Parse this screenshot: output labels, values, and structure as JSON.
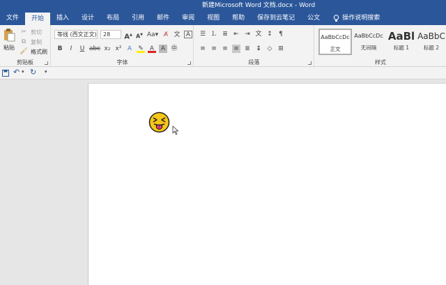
{
  "window": {
    "title": "新建Microsoft Word 文档.docx  -  Word"
  },
  "tabs": [
    "文件",
    "开始",
    "插入",
    "设计",
    "布局",
    "引用",
    "邮件",
    "审阅",
    "视图",
    "帮助",
    "保存到云笔记",
    "公文"
  ],
  "tell_me": {
    "label": "操作说明搜索",
    "icon": "lightbulb-icon"
  },
  "clipboard": {
    "paste": "粘贴",
    "cut": "剪切",
    "copy": "复制",
    "format_painter": "格式刷",
    "group_label": "剪贴板"
  },
  "font": {
    "name": "等线 (西文正文)",
    "size": "28",
    "group_label": "字体",
    "buttons": [
      "A",
      "A",
      "Aa",
      "A",
      "A"
    ],
    "format": [
      "B",
      "I",
      "U",
      "abc",
      "x₂",
      "x²",
      "A",
      "A",
      "A",
      "A"
    ]
  },
  "paragraph": {
    "group_label": "段落"
  },
  "styles": {
    "group_label": "样式",
    "items": [
      {
        "preview": "AaBbCcDc",
        "name": "正文"
      },
      {
        "preview": "AaBbCcDc",
        "name": "无间隔"
      },
      {
        "preview": "AaBl",
        "name": "标题 1"
      },
      {
        "preview": "AaBbC",
        "name": "标题 2"
      }
    ]
  },
  "colors": {
    "accent": "#2b579a",
    "ribbon": "#f3f3f3",
    "emoji_face": "#f5c518"
  },
  "document": {
    "emoji": "squinting-face-with-tongue-icon"
  }
}
